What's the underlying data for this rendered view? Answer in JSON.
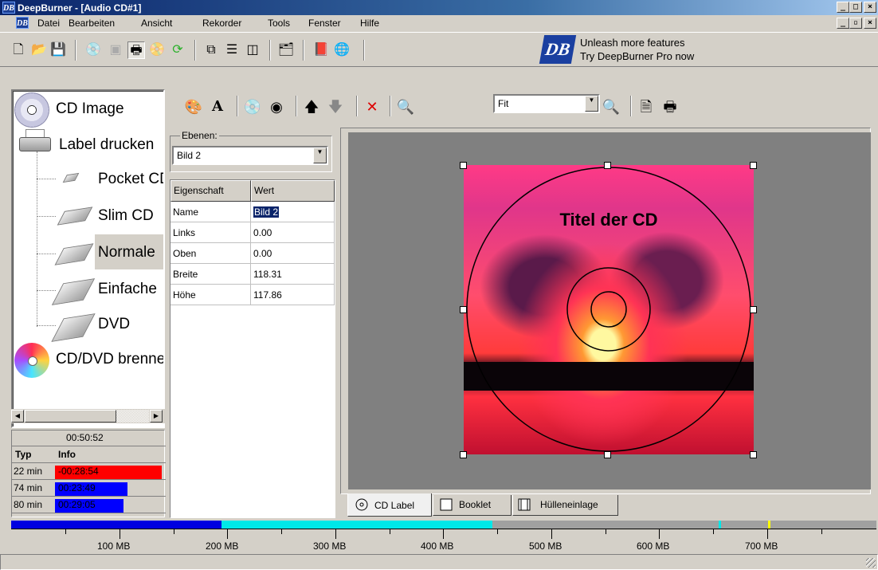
{
  "window": {
    "title": "DeepBurner - [Audio CD#1]",
    "app_icon_text": "DB",
    "min_label": "_",
    "max_label": "□",
    "close_label": "×",
    "restore_label": "▫"
  },
  "menu": {
    "items": [
      "Datei",
      "Bearbeiten",
      "Ansicht",
      "Rekorder",
      "Tools",
      "Fenster",
      "Hilfe"
    ]
  },
  "promo": {
    "logo_text": "DB",
    "line1": "Unleash more features",
    "line2": "Try DeepBurner Pro now"
  },
  "tree": {
    "items": [
      {
        "label": "CD Image"
      },
      {
        "label": "Label drucken"
      },
      {
        "label": "Pocket CD"
      },
      {
        "label": "Slim CD"
      },
      {
        "label": "Normale"
      },
      {
        "label": "Einfache"
      },
      {
        "label": "DVD"
      },
      {
        "label": "CD/DVD brennen"
      }
    ]
  },
  "time": {
    "total": "00:50:52",
    "head_type": "Typ",
    "head_info": "Info",
    "rows": [
      {
        "type": "22 min",
        "info": "-00:28:54",
        "color": "#ff0000",
        "fill": 1.0
      },
      {
        "type": "74 min",
        "info": "00:23:49",
        "color": "#0000ff",
        "fill": 0.68
      },
      {
        "type": "80 min",
        "info": "00:29:05",
        "color": "#0000ff",
        "fill": 0.64
      }
    ]
  },
  "layers": {
    "group_label": "Ebenen:",
    "selected": "Bild 2",
    "col_property": "Eigenschaft",
    "col_value": "Wert",
    "rows": [
      {
        "prop": "Name",
        "value": "Bild 2"
      },
      {
        "prop": "Links",
        "value": "0.00"
      },
      {
        "prop": "Oben",
        "value": "0.00"
      },
      {
        "prop": "Breite",
        "value": "118.31"
      },
      {
        "prop": "Höhe",
        "value": "117.86"
      }
    ]
  },
  "toolbar2": {
    "zoom_value": "Fit",
    "text_tool": "A"
  },
  "canvas": {
    "cd_title": "Titel der CD"
  },
  "tabs": [
    {
      "label": "CD Label",
      "active": true
    },
    {
      "label": "Booklet",
      "active": false
    },
    {
      "label": "Hülleneinlage",
      "active": false
    }
  ],
  "size": {
    "used_color": "#0000e0",
    "audio_color": "#00e8e8",
    "labels": [
      "100 MB",
      "200 MB",
      "300 MB",
      "400 MB",
      "500 MB",
      "600 MB",
      "700 MB"
    ]
  }
}
